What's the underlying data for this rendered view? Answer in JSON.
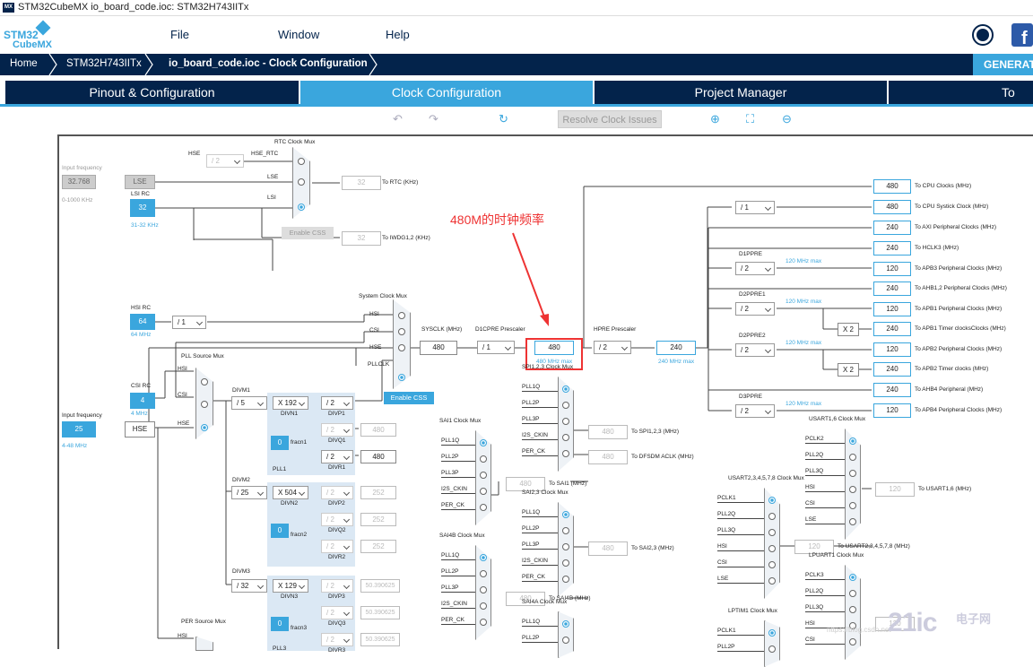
{
  "window": {
    "title": "STM32CubeMX io_board_code.ioc: STM32H743IITx",
    "icon_label": "MX"
  },
  "logo": {
    "line1": "STM32",
    "line2": "CubeMX"
  },
  "menu": {
    "file": "File",
    "window": "Window",
    "help": "Help"
  },
  "breadcrumb": {
    "home": "Home",
    "device": "STM32H743IITx",
    "file": "io_board_code.ioc - Clock Configuration",
    "generate": "GENERAT"
  },
  "tabs": [
    "Pinout & Configuration",
    "Clock Configuration",
    "Project Manager",
    "To"
  ],
  "toolbar": {
    "resolve": "Resolve Clock Issues"
  },
  "annotation": "480M的时钟频率",
  "watermark": {
    "brand": "21ic",
    "sub": "电子网",
    "url": "https://blog.csdn.net"
  },
  "clock": {
    "input_freq_label": "Input frequency",
    "lse_input": "32.768",
    "lse_range": "0-1000 KHz",
    "lse": "LSE",
    "lsi_rc": "LSI RC",
    "lsi_val": "32",
    "lsi_range": "31-32 KHz",
    "rtc_mux": "RTC Clock Mux",
    "hse_lbl": "HSE",
    "hse_rtc": "HSE_RTC",
    "lse_lbl": "LSE",
    "lsi_lbl": "LSI",
    "div2": "/ 2",
    "rtc_out": "32",
    "rtc_to": "To RTC (KHz)",
    "enable_css": "Enable CSS",
    "iwdg_out": "32",
    "iwdg_to": "To IWDG1,2 (KHz)",
    "hsi_rc": "HSI RC",
    "hsi_val": "64",
    "hsi_freq": "64 MHz",
    "hsi_div": "/ 1",
    "sys_mux": "System Clock Mux",
    "hsi": "HSI",
    "csi": "CSI",
    "hse": "HSE",
    "pllclk": "PLLCLK",
    "sysclk_lbl": "SYSCLK (MHz)",
    "sysclk": "480",
    "d1cpre_lbl": "D1CPRE Prescaler",
    "d1cpre": "/ 1",
    "d1_out": "480",
    "d1_max": "480 MHz max",
    "hpre_lbl": "HPRE Prescaler",
    "hpre": "/ 2",
    "hpre_out": "240",
    "hpre_max": "240 MHz max",
    "enable_css2": "Enable CSS",
    "pll_src_mux": "PLL Source Mux",
    "csi_rc": "CSI RC",
    "csi_val": "4",
    "csi_freq": "4 MHz",
    "hse_input": "25",
    "hse_range": "4-48 MHz",
    "divm1": "DIVM1",
    "divm1_val": "/ 5",
    "divn1_val": "X 192",
    "divn1": "DIVN1",
    "divp1_val": "/ 2",
    "divp1": "DIVP1",
    "divq1_val": "/ 2",
    "divq1": "DIVQ1",
    "divq1_out": "480",
    "divr1_val": "/ 2",
    "divr1": "DIVR1",
    "divr1_out": "480",
    "fracn1_val": "0",
    "fracn1": "fracn1",
    "pll1": "PLL1",
    "divm2": "DIVM2",
    "divm2_val": "/ 25",
    "divn2_val": "X 504",
    "divn2": "DIVN2",
    "divp2_val": "/ 2",
    "divp2": "DIVP2",
    "divp2_out": "252",
    "divq2_val": "/ 2",
    "divq2": "DIVQ2",
    "divq2_out": "252",
    "divr2_val": "/ 2",
    "divr2": "DIVR2",
    "divr2_out": "252",
    "fracn2_val": "0",
    "fracn2": "fracn2",
    "divm3": "DIVM3",
    "divm3_val": "/ 32",
    "divn3_val": "X 129",
    "divn3": "DIVN3",
    "divp3_val": "/ 2",
    "divp3": "DIVP3",
    "divp3_out": "50.390625",
    "divq3_val": "/ 2",
    "divq3": "DIVQ3",
    "divq3_out": "50.390625",
    "divr3_val": "/ 2",
    "divr3": "DIVR3",
    "divr3_out": "50.390625",
    "fracn3_val": "0",
    "fracn3": "fracn3",
    "pll3": "PLL3",
    "per_mux": "PER Source Mux",
    "div_sys": "/ 1",
    "d1ppre": "D1PPRE",
    "d1ppre_val": "/ 2",
    "d1ppre_max": "120 MHz max",
    "d2ppre1": "D2PPRE1",
    "d2ppre1_val": "/ 2",
    "d2ppre1_max": "120 MHz max",
    "d2ppre2": "D2PPRE2",
    "d2ppre2_val": "/ 2",
    "d2ppre2_max": "120 MHz max",
    "d3ppre": "D3PPRE",
    "d3ppre_val": "/ 2",
    "d3ppre_max": "120 MHz max",
    "x2a": "X 2",
    "x2b": "X 2",
    "outputs": [
      {
        "val": "480",
        "to": "To CPU Clocks (MHz)"
      },
      {
        "val": "480",
        "to": "To CPU Systick Clock (MHz)"
      },
      {
        "val": "240",
        "to": "To AXI Peripheral Clocks (MHz)"
      },
      {
        "val": "240",
        "to": "To HCLK3 (MHz)"
      },
      {
        "val": "120",
        "to": "To APB3 Peripheral Clocks (MHz)"
      },
      {
        "val": "240",
        "to": "To AHB1,2 Peripheral Clocks (MHz)"
      },
      {
        "val": "120",
        "to": "To APB1 Peripheral Clocks (MHz)"
      },
      {
        "val": "240",
        "to": "To APB1 Timer clocksClocks (MHz)"
      },
      {
        "val": "120",
        "to": "To APB2 Peripheral Clocks (MHz)"
      },
      {
        "val": "240",
        "to": "To APB2 Timer clocks (MHz)"
      },
      {
        "val": "240",
        "to": "To AHB4 Peripheral (MHz)"
      },
      {
        "val": "120",
        "to": "To APB4 Peripheral Clocks (MHz)"
      }
    ],
    "spi123_mux": "SPI1,2,3 Clock Mux",
    "spi_in": [
      "PLL1Q",
      "PLL2P",
      "PLL3P",
      "I2S_CKIN",
      "PER_CK"
    ],
    "spi123_out": "480",
    "spi123_to": "To SPI1,2,3 (MHz)",
    "dfsdm_out": "480",
    "dfsdm_to": "To DFSDM ACLK (MHz)",
    "sai1_mux": "SAI1 Clock Mux",
    "sai_in": [
      "PLL1Q",
      "PLL2P",
      "PLL3P",
      "I2S_CKIN",
      "PER_CK"
    ],
    "sai1_out": "480",
    "sai1_to": "To SAI1 (MHz)",
    "sai23_mux": "SAI2,3 Clock Mux",
    "sai23_out": "480",
    "sai23_to": "To SAI2,3 (MHz)",
    "sai4b_mux": "SAI4B Clock Mux",
    "sai4b_out": "480",
    "sai4b_to": "To SAI4B (MHz)",
    "sai4a_mux": "SAI4A Clock Mux",
    "sai4a_in": [
      "PLL1Q",
      "PLL2P"
    ],
    "usart16_mux": "USART1,6 Clock Mux",
    "usart16_in": [
      "PCLK2",
      "PLL2Q",
      "PLL3Q",
      "HSI",
      "CSI",
      "LSE"
    ],
    "usart16_out": "120",
    "usart16_to": "To USART1,6 (MHz)",
    "usart2_mux": "USART2,3,4,5,7,8 Clock Mux",
    "usart2_in": [
      "PCLK1",
      "PLL2Q",
      "PLL3Q",
      "HSI",
      "CSI",
      "LSE"
    ],
    "usart2_out": "120",
    "usart2_to": "To USART2,3,4,5,7,8 (MHz)",
    "lpuart_mux": "LPUART1 Clock Mux",
    "lpuart_in": [
      "PCLK3",
      "PLL2Q",
      "PLL3Q",
      "HSI",
      "CSI"
    ],
    "lpuart_out": "120",
    "lptim_mux": "LPTIM1 Clock Mux",
    "lptim_in": [
      "PCLK1",
      "PLL2P"
    ],
    "per_hsi": "HSI"
  }
}
